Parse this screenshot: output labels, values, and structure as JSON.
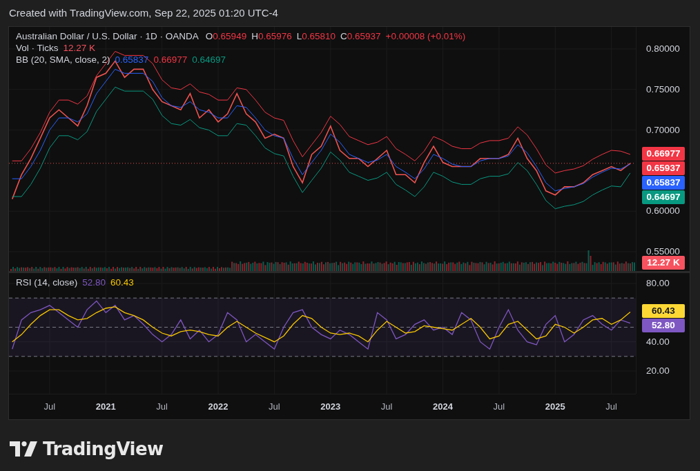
{
  "caption": "Created with TradingView.com, Sep 22, 2025 01:20 UTC-4",
  "price_pane": {
    "ohlc": [
      {
        "key": "O",
        "value": "0.65949"
      },
      {
        "key": "H",
        "value": "0.65976"
      },
      {
        "key": "L",
        "value": "0.65810"
      },
      {
        "key": "C",
        "value": "0.65937"
      }
    ],
    "change": "+0.00008 (+0.01%)",
    "volume_legend": {
      "title": "Vol · Ticks",
      "value": "12.27 K"
    },
    "bb_legend": {
      "title": "BB (20, SMA, close, 2)",
      "values": [
        {
          "value": "0.65837",
          "color": "#2962ff"
        },
        {
          "value": "0.66977",
          "color": "#f23645"
        },
        {
          "value": "0.64697",
          "color": "#089981"
        }
      ]
    },
    "axis_labels": [
      {
        "text": "0.66977",
        "color": "#f23645",
        "kind": "price"
      },
      {
        "text": "0.65937",
        "color": "#f23645",
        "kind": "price"
      },
      {
        "text": "0.65837",
        "color": "#2962ff",
        "kind": "price"
      },
      {
        "text": "0.64697",
        "color": "#089981",
        "kind": "price"
      },
      {
        "text": "12.27 K",
        "color": "#f7525f",
        "kind": "volume"
      }
    ],
    "chart_data": {
      "type": "line",
      "grid": true,
      "xlim": [
        2020.138,
        2025.717
      ],
      "ylim": [
        0.5262,
        0.8272
      ],
      "ref_lines": [
        {
          "axis": "y",
          "value": 0.659,
          "color": "#ef5350"
        }
      ],
      "x": [
        2020.167,
        2020.25,
        2020.333,
        2020.417,
        2020.5,
        2020.583,
        2020.667,
        2020.75,
        2020.833,
        2020.917,
        2021,
        2021.083,
        2021.167,
        2021.25,
        2021.333,
        2021.417,
        2021.5,
        2021.583,
        2021.667,
        2021.75,
        2021.833,
        2021.917,
        2022,
        2022.083,
        2022.167,
        2022.25,
        2022.333,
        2022.417,
        2022.5,
        2022.583,
        2022.667,
        2022.75,
        2022.833,
        2022.917,
        2023,
        2023.083,
        2023.167,
        2023.25,
        2023.333,
        2023.417,
        2023.5,
        2023.583,
        2023.667,
        2023.75,
        2023.833,
        2023.917,
        2024,
        2024.083,
        2024.167,
        2024.25,
        2024.333,
        2024.417,
        2024.5,
        2024.583,
        2024.667,
        2024.75,
        2024.833,
        2024.917,
        2025,
        2025.083,
        2025.167,
        2025.25,
        2025.333,
        2025.417,
        2025.5,
        2025.583,
        2025.667
      ],
      "yticks": [
        {
          "value": 0.55,
          "label": "0.55000"
        },
        {
          "value": 0.6,
          "label": "0.60000"
        },
        {
          "value": 0.7,
          "label": "0.70000"
        },
        {
          "value": 0.75,
          "label": "0.75000"
        },
        {
          "value": 0.8,
          "label": "0.80000"
        }
      ],
      "series": [
        {
          "name": "Australian Dollar / U.S. Dollar · 1D · OANDA",
          "color": "#ef5350",
          "values": [
            0.615,
            0.645,
            0.665,
            0.69,
            0.715,
            0.725,
            0.715,
            0.705,
            0.73,
            0.765,
            0.77,
            0.785,
            0.765,
            0.775,
            0.775,
            0.75,
            0.735,
            0.73,
            0.725,
            0.745,
            0.715,
            0.725,
            0.71,
            0.72,
            0.745,
            0.72,
            0.71,
            0.69,
            0.695,
            0.69,
            0.655,
            0.635,
            0.67,
            0.68,
            0.705,
            0.675,
            0.665,
            0.665,
            0.655,
            0.665,
            0.675,
            0.645,
            0.645,
            0.635,
            0.66,
            0.68,
            0.66,
            0.655,
            0.655,
            0.655,
            0.665,
            0.665,
            0.665,
            0.67,
            0.69,
            0.665,
            0.65,
            0.625,
            0.62,
            0.63,
            0.63,
            0.635,
            0.645,
            0.65,
            0.655,
            0.65,
            0.659
          ]
        },
        {
          "color": "#f23645",
          "values": [
            0.662,
            0.662,
            0.677,
            0.697,
            0.722,
            0.737,
            0.737,
            0.732,
            0.742,
            0.767,
            0.782,
            0.797,
            0.792,
            0.792,
            0.792,
            0.782,
            0.762,
            0.752,
            0.75,
            0.757,
            0.747,
            0.744,
            0.737,
            0.737,
            0.752,
            0.75,
            0.737,
            0.722,
            0.715,
            0.712,
            0.687,
            0.667,
            0.682,
            0.697,
            0.717,
            0.707,
            0.692,
            0.687,
            0.682,
            0.685,
            0.692,
            0.677,
            0.67,
            0.662,
            0.674,
            0.692,
            0.687,
            0.68,
            0.677,
            0.677,
            0.684,
            0.687,
            0.687,
            0.69,
            0.704,
            0.694,
            0.677,
            0.657,
            0.647,
            0.65,
            0.652,
            0.656,
            0.664,
            0.67,
            0.675,
            0.674,
            0.67
          ]
        },
        {
          "color": "#2962ff",
          "values": [
            0.64,
            0.64,
            0.655,
            0.675,
            0.7,
            0.715,
            0.715,
            0.71,
            0.72,
            0.745,
            0.76,
            0.775,
            0.77,
            0.77,
            0.77,
            0.76,
            0.74,
            0.73,
            0.728,
            0.735,
            0.725,
            0.722,
            0.715,
            0.715,
            0.73,
            0.728,
            0.715,
            0.7,
            0.693,
            0.69,
            0.665,
            0.645,
            0.66,
            0.675,
            0.695,
            0.685,
            0.67,
            0.665,
            0.66,
            0.663,
            0.67,
            0.655,
            0.648,
            0.64,
            0.652,
            0.67,
            0.665,
            0.658,
            0.655,
            0.655,
            0.662,
            0.665,
            0.665,
            0.668,
            0.682,
            0.672,
            0.655,
            0.635,
            0.625,
            0.628,
            0.63,
            0.634,
            0.642,
            0.648,
            0.653,
            0.652,
            0.658
          ]
        },
        {
          "color": "#089981",
          "values": [
            0.618,
            0.618,
            0.633,
            0.653,
            0.678,
            0.693,
            0.693,
            0.688,
            0.698,
            0.723,
            0.738,
            0.753,
            0.748,
            0.748,
            0.748,
            0.738,
            0.718,
            0.708,
            0.706,
            0.713,
            0.703,
            0.7,
            0.693,
            0.693,
            0.708,
            0.706,
            0.693,
            0.678,
            0.671,
            0.668,
            0.643,
            0.623,
            0.638,
            0.653,
            0.673,
            0.663,
            0.648,
            0.643,
            0.638,
            0.641,
            0.648,
            0.633,
            0.626,
            0.618,
            0.63,
            0.648,
            0.643,
            0.636,
            0.633,
            0.633,
            0.64,
            0.643,
            0.643,
            0.646,
            0.66,
            0.65,
            0.633,
            0.613,
            0.603,
            0.606,
            0.608,
            0.612,
            0.62,
            0.626,
            0.631,
            0.63,
            0.647
          ]
        }
      ]
    }
  },
  "rsi_pane": {
    "values": [
      {
        "value": "52.80",
        "color": "#7e57c2"
      },
      {
        "value": "60.43",
        "color": "#f7c600"
      }
    ],
    "axis_labels": [
      {
        "text": "60.43",
        "color": "#fdd835",
        "kind": "price"
      },
      {
        "text": "52.80",
        "color": "#7e57c2",
        "kind": "price"
      }
    ],
    "chart_data": {
      "type": "line",
      "grid": true,
      "xlim": [
        2020.138,
        2025.717
      ],
      "ylim": [
        4.4,
        87.1
      ],
      "ref_lines": [
        {
          "axis": "y",
          "value": 70,
          "color": "#787b86"
        },
        {
          "axis": "y",
          "value": 50,
          "color": "#787b86"
        },
        {
          "axis": "y",
          "value": 30,
          "color": "#787b86"
        }
      ],
      "bands": [
        {
          "axis": "y",
          "from": 30,
          "to": 70,
          "color": "#7e57c2"
        }
      ],
      "x": [
        2020.167,
        2020.25,
        2020.333,
        2020.417,
        2020.5,
        2020.583,
        2020.667,
        2020.75,
        2020.833,
        2020.917,
        2021,
        2021.083,
        2021.167,
        2021.25,
        2021.333,
        2021.417,
        2021.5,
        2021.583,
        2021.667,
        2021.75,
        2021.833,
        2021.917,
        2022,
        2022.083,
        2022.167,
        2022.25,
        2022.333,
        2022.417,
        2022.5,
        2022.583,
        2022.667,
        2022.75,
        2022.833,
        2022.917,
        2023,
        2023.083,
        2023.167,
        2023.25,
        2023.333,
        2023.417,
        2023.5,
        2023.583,
        2023.667,
        2023.75,
        2023.833,
        2023.917,
        2024,
        2024.083,
        2024.167,
        2024.25,
        2024.333,
        2024.417,
        2024.5,
        2024.583,
        2024.667,
        2024.75,
        2024.833,
        2024.917,
        2025,
        2025.083,
        2025.167,
        2025.25,
        2025.333,
        2025.417,
        2025.5,
        2025.583,
        2025.667
      ],
      "xticks": [
        {
          "value": 2020.5,
          "label": "Jul"
        },
        2021,
        {
          "value": 2021.5,
          "label": "Jul"
        },
        2022,
        {
          "value": 2022.5,
          "label": "Jul"
        },
        2023,
        {
          "value": 2023.5,
          "label": "Jul"
        },
        2024,
        {
          "value": 2024.5,
          "label": "Jul"
        },
        2025,
        {
          "value": 2025.5,
          "label": "Jul"
        }
      ],
      "yticks": [
        {
          "value": 20,
          "label": "20.00"
        },
        {
          "value": 40,
          "label": "40.00"
        },
        {
          "value": 80,
          "label": "80.00"
        }
      ],
      "series": [
        {
          "name": "RSI (14, close)",
          "color": "#7e57c2",
          "values": [
            35,
            55,
            60,
            62,
            65,
            60,
            55,
            50,
            62,
            68,
            60,
            65,
            55,
            58,
            52,
            45,
            40,
            45,
            55,
            42,
            48,
            40,
            45,
            60,
            55,
            40,
            45,
            40,
            35,
            50,
            60,
            62,
            50,
            45,
            42,
            48,
            45,
            40,
            35,
            60,
            55,
            42,
            45,
            52,
            55,
            48,
            50,
            45,
            60,
            55,
            40,
            35,
            50,
            62,
            48,
            40,
            38,
            52,
            58,
            40,
            45,
            55,
            58,
            52,
            48,
            55,
            52.8
          ]
        },
        {
          "color": "#f7c600",
          "values": [
            40,
            45,
            52,
            58,
            62,
            62,
            58,
            55,
            56,
            60,
            63,
            64,
            60,
            58,
            55,
            50,
            46,
            44,
            47,
            48,
            47,
            45,
            44,
            50,
            54,
            50,
            46,
            43,
            40,
            44,
            52,
            58,
            56,
            50,
            46,
            45,
            46,
            44,
            40,
            48,
            54,
            50,
            46,
            47,
            51,
            50,
            49,
            48,
            52,
            56,
            50,
            42,
            44,
            52,
            54,
            48,
            42,
            44,
            52,
            50,
            46,
            50,
            55,
            56,
            52,
            55,
            60.4
          ]
        }
      ]
    }
  },
  "brand": "TradingView"
}
